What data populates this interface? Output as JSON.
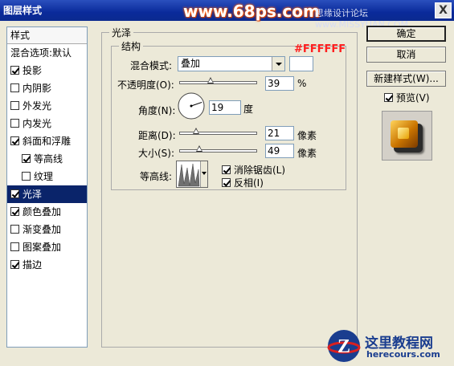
{
  "window": {
    "title": "图层样式",
    "close_glyph": "X"
  },
  "overlays": {
    "watermark": "www.68ps.com",
    "watermark2": "思缘设计论坛 www.MISSYUAN.COM",
    "color_note": "#FFFFFF",
    "logo_cn": "这里教程网",
    "logo_url": "herecours.com"
  },
  "sidebar": {
    "header": "样式",
    "items": [
      {
        "label": "混合选项:默认",
        "checkbox": false,
        "checked": false
      },
      {
        "label": "投影",
        "checkbox": true,
        "checked": true
      },
      {
        "label": "内阴影",
        "checkbox": true,
        "checked": false
      },
      {
        "label": "外发光",
        "checkbox": true,
        "checked": false
      },
      {
        "label": "内发光",
        "checkbox": true,
        "checked": false
      },
      {
        "label": "斜面和浮雕",
        "checkbox": true,
        "checked": true
      },
      {
        "label": "等高线",
        "checkbox": true,
        "checked": true
      },
      {
        "label": "纹理",
        "checkbox": true,
        "checked": false
      },
      {
        "label": "光泽",
        "checkbox": true,
        "checked": true
      },
      {
        "label": "颜色叠加",
        "checkbox": true,
        "checked": true
      },
      {
        "label": "渐变叠加",
        "checkbox": true,
        "checked": false
      },
      {
        "label": "图案叠加",
        "checkbox": true,
        "checked": false
      },
      {
        "label": "描边",
        "checkbox": true,
        "checked": true
      }
    ]
  },
  "panel": {
    "title": "光泽",
    "group": "结构",
    "blend_mode_label": "混合模式:",
    "blend_mode_value": "叠加",
    "opacity_label": "不透明度(O):",
    "opacity_value": "39",
    "opacity_unit": "%",
    "opacity_level": 0.39,
    "angle_label": "角度(N):",
    "angle_value": "19",
    "angle_unit": "度",
    "distance_label": "距离(D):",
    "distance_value": "21",
    "distance_unit": "像素",
    "size_label": "大小(S):",
    "size_value": "49",
    "size_unit": "像素",
    "contour_label": "等高线:",
    "anti_alias_label": "消除锯齿(L)",
    "anti_alias_checked": true,
    "invert_label": "反相(I)",
    "invert_checked": true
  },
  "buttons": {
    "ok": "确定",
    "cancel": "取消",
    "new_style": "新建样式(W)...",
    "preview": "预览(V)",
    "preview_checked": true
  },
  "colors": {
    "selection": "#0a246a",
    "gloss_swatch": "#ffffff",
    "title_bar": "#0a2a9a"
  }
}
